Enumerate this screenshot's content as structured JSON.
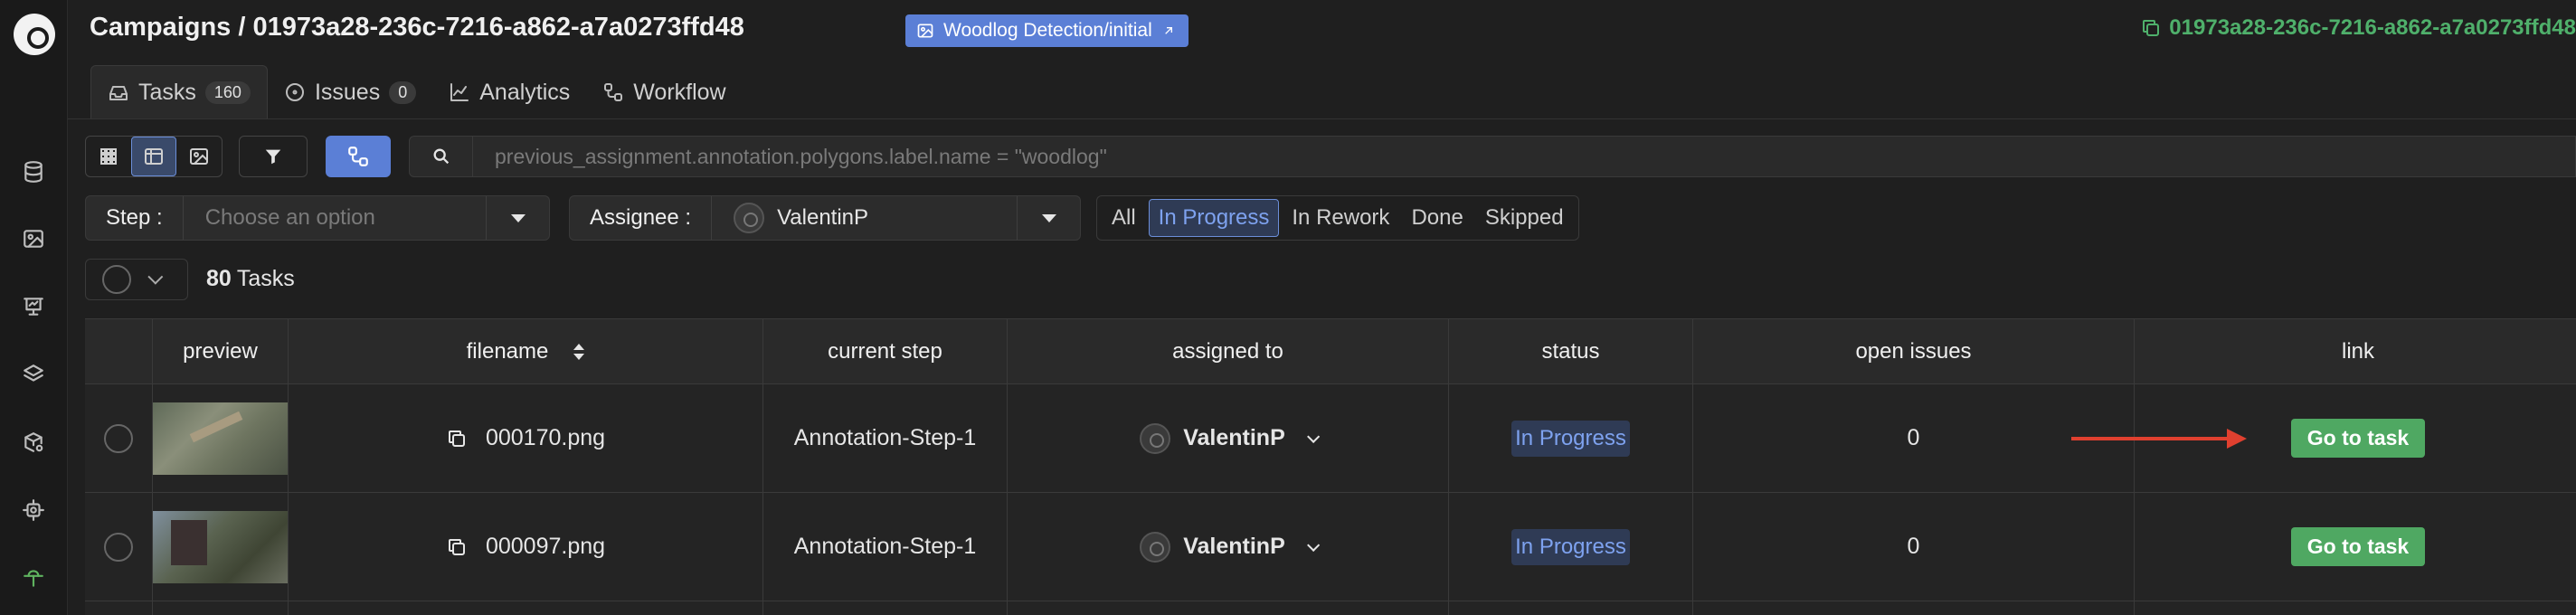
{
  "header": {
    "title": "Campaigns / 01973a28-236c-7216-a862-a7a0273ffd48",
    "project_tag": "Woodlog Detection/initial",
    "copy_id": "01973a28-236c-7216-a862-a7a0273ffd48"
  },
  "tabs": [
    {
      "label": "Tasks",
      "count": "160",
      "icon": "inbox-icon"
    },
    {
      "label": "Issues",
      "count": "0",
      "icon": "issue-icon"
    },
    {
      "label": "Analytics",
      "icon": "chart-icon"
    },
    {
      "label": "Workflow",
      "icon": "workflow-icon"
    }
  ],
  "search": {
    "placeholder": "previous_assignment.annotation.polygons.label.name = \"woodlog\""
  },
  "filters": {
    "step_label": "Step :",
    "step_placeholder": "Choose an option",
    "assignee_label": "Assignee :",
    "assignee_value": "ValentinP",
    "status_options": [
      "All",
      "In Progress",
      "In Rework",
      "Done",
      "Skipped"
    ],
    "status_selected": "In Progress"
  },
  "task_count": {
    "number": "80",
    "label": "Tasks"
  },
  "table": {
    "headers": [
      "preview",
      "filename",
      "current step",
      "assigned to",
      "status",
      "open issues",
      "link"
    ],
    "rows": [
      {
        "filename": "000170.png",
        "step": "Annotation-Step-1",
        "assignee": "ValentinP",
        "status": "In Progress",
        "issues": "0",
        "link": "Go to task"
      },
      {
        "filename": "000097.png",
        "step": "Annotation-Step-1",
        "assignee": "ValentinP",
        "status": "In Progress",
        "issues": "0",
        "link": "Go to task"
      }
    ]
  },
  "colors": {
    "accent": "#5b7fd6",
    "success": "#4fa862",
    "arrow": "#e0402f"
  }
}
